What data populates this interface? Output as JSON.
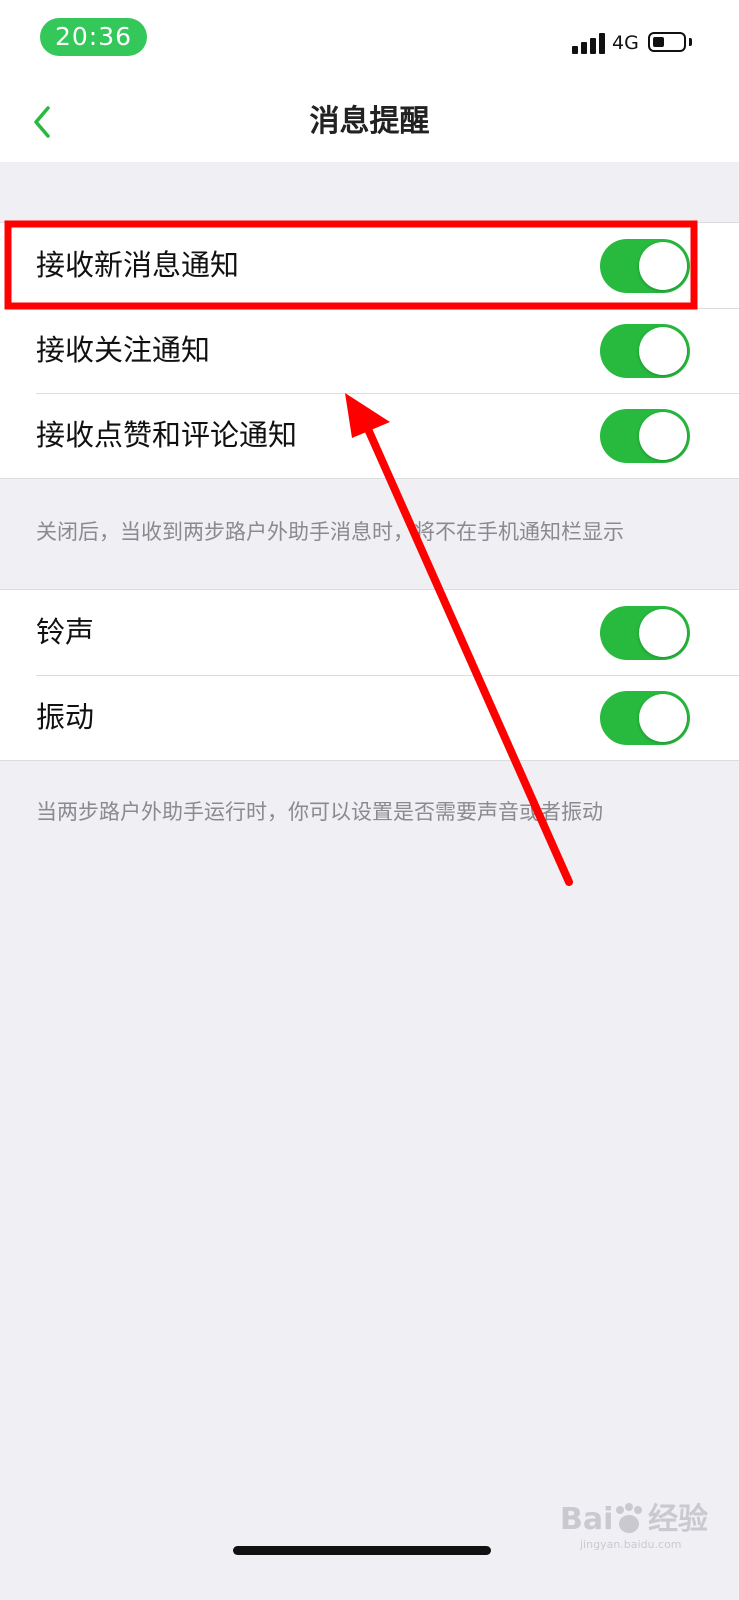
{
  "status_bar": {
    "time": "20:36",
    "network": "4G"
  },
  "nav": {
    "title": "消息提醒"
  },
  "group1": {
    "items": [
      {
        "label": "接收新消息通知",
        "enabled": true
      },
      {
        "label": "接收关注通知",
        "enabled": true
      },
      {
        "label": "接收点赞和评论通知",
        "enabled": true
      }
    ],
    "footnote": "关闭后，当收到两步路户外助手消息时，将不在手机通知栏显示"
  },
  "group2": {
    "items": [
      {
        "label": "铃声",
        "enabled": true
      },
      {
        "label": "振动",
        "enabled": true
      }
    ],
    "footnote": "当两步路户外助手运行时，你可以设置是否需要声音或者振动"
  },
  "colors": {
    "toggle_on": "#27ba3e",
    "highlight": "#ff0000",
    "time_pill": "#34c759"
  },
  "watermark": {
    "brand": "Bai",
    "brand_suffix": "经验",
    "site": "jingyan.baidu.com"
  }
}
